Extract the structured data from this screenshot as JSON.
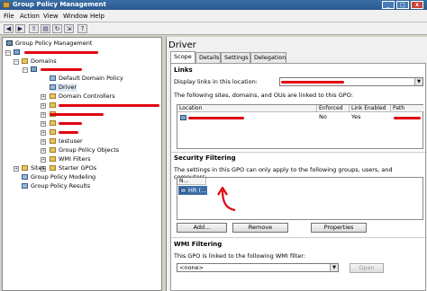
{
  "window": {
    "title": "Group Policy Management"
  },
  "menu": [
    "File",
    "Action",
    "View",
    "Window",
    "Help"
  ],
  "tree": {
    "root": "Group Policy Management",
    "domains": "Domains",
    "default_policy": "Default Domain Policy",
    "driver": "Driver",
    "domain_controllers": "Domain Controllers",
    "testuser": "testuser",
    "gpo": "Group Policy Objects",
    "wmi": "WMI Filters",
    "starter": "Starter GPOs",
    "sites": "Sites",
    "modeling": "Group Policy Modeling",
    "results": "Group Policy Results"
  },
  "panel": {
    "title": "Driver",
    "tabs": [
      "Scope",
      "Details",
      "Settings",
      "Delegation"
    ],
    "links": {
      "heading": "Links",
      "display_label": "Display links in this location:",
      "linked_label": "The following sites, domains, and OUs are linked to this GPO:",
      "columns": [
        "Location",
        "Enforced",
        "Link Enabled",
        "Path"
      ],
      "row": {
        "enforced": "No",
        "link_enabled": "Yes"
      }
    },
    "security": {
      "heading": "Security Filtering",
      "desc": "The settings in this GPO can only apply to the following groups, users, and computers:",
      "column": "N...",
      "item": "HR (...",
      "buttons": {
        "add": "Add...",
        "remove": "Remove",
        "properties": "Properties"
      }
    },
    "wmi": {
      "heading": "WMI Filtering",
      "desc": "This GPO is linked to the following WMI filter:",
      "value": "<none>",
      "open": "Open"
    }
  },
  "colors": {
    "redaction": "#e00010",
    "annotation_arrow": "#e00010"
  }
}
